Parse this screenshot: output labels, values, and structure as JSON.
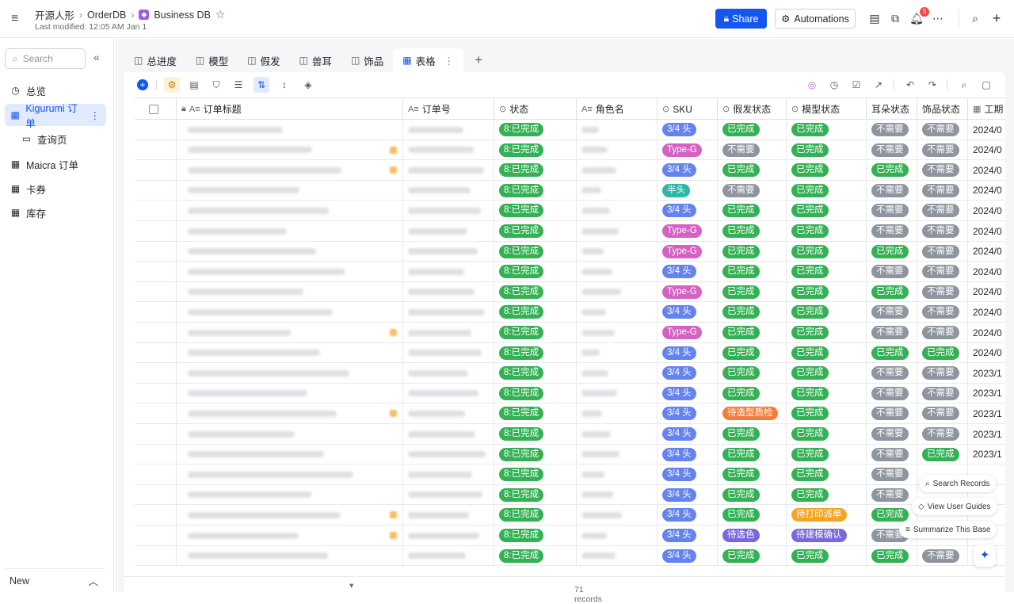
{
  "header": {
    "breadcrumb": [
      "开源人形",
      "OrderDB",
      "Business DB"
    ],
    "last_modified": "Last modified: 12:05 AM Jan 1",
    "share_label": "Share",
    "automations_label": "Automations",
    "notification_count": "5"
  },
  "sidebar": {
    "search_placeholder": "Search",
    "items": [
      {
        "label": "总览",
        "icon": "clock-icon"
      },
      {
        "label": "Kigurumi 订单",
        "icon": "table-icon",
        "active": true
      },
      {
        "label": "查询页",
        "icon": "form-icon"
      },
      {
        "label": "Maicra 订单",
        "icon": "table-icon"
      },
      {
        "label": "卡券",
        "icon": "table-icon"
      },
      {
        "label": "库存",
        "icon": "table-icon"
      }
    ],
    "new_label": "New"
  },
  "tabs": [
    {
      "label": "总进度"
    },
    {
      "label": "模型"
    },
    {
      "label": "假发"
    },
    {
      "label": "兽耳"
    },
    {
      "label": "饰品"
    },
    {
      "label": "表格",
      "active": true
    }
  ],
  "columns": [
    "订单标题",
    "订单号",
    "状态",
    "角色名",
    "SKU",
    "假发状态",
    "模型状态",
    "耳朵状态",
    "饰品状态",
    "工期"
  ],
  "rows": [
    {
      "status": "8:已完成",
      "sku": "3/4 头",
      "wig": "已完成",
      "model": "已完成",
      "ear": "不需要",
      "acc": "不需要",
      "date": "2024/0",
      "dot": false
    },
    {
      "status": "8:已完成",
      "sku": "Type-G",
      "wig": "不需要",
      "model": "已完成",
      "ear": "不需要",
      "acc": "不需要",
      "date": "2024/0",
      "dot": true
    },
    {
      "status": "8:已完成",
      "sku": "3/4 头",
      "wig": "已完成",
      "model": "已完成",
      "ear": "已完成",
      "acc": "不需要",
      "date": "2024/0",
      "dot": true
    },
    {
      "status": "8:已完成",
      "sku": "半头",
      "wig": "不需要",
      "model": "已完成",
      "ear": "不需要",
      "acc": "不需要",
      "date": "2024/0",
      "dot": false
    },
    {
      "status": "8:已完成",
      "sku": "3/4 头",
      "wig": "已完成",
      "model": "已完成",
      "ear": "不需要",
      "acc": "不需要",
      "date": "2024/0",
      "dot": false
    },
    {
      "status": "8:已完成",
      "sku": "Type-G",
      "wig": "已完成",
      "model": "已完成",
      "ear": "不需要",
      "acc": "不需要",
      "date": "2024/0",
      "dot": false
    },
    {
      "status": "8:已完成",
      "sku": "Type-G",
      "wig": "已完成",
      "model": "已完成",
      "ear": "已完成",
      "acc": "不需要",
      "date": "2024/0",
      "dot": false
    },
    {
      "status": "8:已完成",
      "sku": "3/4 头",
      "wig": "已完成",
      "model": "已完成",
      "ear": "不需要",
      "acc": "不需要",
      "date": "2024/0",
      "dot": false
    },
    {
      "status": "8:已完成",
      "sku": "Type-G",
      "wig": "已完成",
      "model": "已完成",
      "ear": "已完成",
      "acc": "不需要",
      "date": "2024/0",
      "dot": false
    },
    {
      "status": "8:已完成",
      "sku": "3/4 头",
      "wig": "已完成",
      "model": "已完成",
      "ear": "不需要",
      "acc": "不需要",
      "date": "2024/0",
      "dot": false
    },
    {
      "status": "8:已完成",
      "sku": "Type-G",
      "wig": "已完成",
      "model": "已完成",
      "ear": "不需要",
      "acc": "不需要",
      "date": "2024/0",
      "dot": true
    },
    {
      "status": "8:已完成",
      "sku": "3/4 头",
      "wig": "已完成",
      "model": "已完成",
      "ear": "已完成",
      "acc": "已完成",
      "date": "2024/0",
      "dot": false
    },
    {
      "status": "8:已完成",
      "sku": "3/4 头",
      "wig": "已完成",
      "model": "已完成",
      "ear": "不需要",
      "acc": "不需要",
      "date": "2023/1",
      "dot": false
    },
    {
      "status": "8:已完成",
      "sku": "3/4 头",
      "wig": "已完成",
      "model": "已完成",
      "ear": "不需要",
      "acc": "不需要",
      "date": "2023/1",
      "dot": false
    },
    {
      "status": "8:已完成",
      "sku": "3/4 头",
      "wig": "待造型质检",
      "model": "已完成",
      "ear": "不需要",
      "acc": "不需要",
      "date": "2023/1",
      "dot": true
    },
    {
      "status": "8:已完成",
      "sku": "3/4 头",
      "wig": "已完成",
      "model": "已完成",
      "ear": "不需要",
      "acc": "不需要",
      "date": "2023/1",
      "dot": false
    },
    {
      "status": "8:已完成",
      "sku": "3/4 头",
      "wig": "已完成",
      "model": "已完成",
      "ear": "不需要",
      "acc": "已完成",
      "date": "2023/1",
      "dot": false
    },
    {
      "status": "8:已完成",
      "sku": "3/4 头",
      "wig": "已完成",
      "model": "已完成",
      "ear": "不需要",
      "acc": "",
      "date": "",
      "dot": false
    },
    {
      "status": "8:已完成",
      "sku": "3/4 头",
      "wig": "已完成",
      "model": "已完成",
      "ear": "不需要",
      "acc": "",
      "date": "",
      "dot": false
    },
    {
      "status": "8:已完成",
      "sku": "3/4 头",
      "wig": "已完成",
      "model": "待打印派单",
      "ear": "已完成",
      "acc": "",
      "date": "",
      "dot": true
    },
    {
      "status": "8:已完成",
      "sku": "3/4 头",
      "wig": "待选色",
      "model": "待建模确认",
      "ear": "不需要",
      "acc": "",
      "date": "",
      "dot": true
    },
    {
      "status": "8:已完成",
      "sku": "3/4 头",
      "wig": "已完成",
      "model": "已完成",
      "ear": "已完成",
      "acc": "不需要",
      "date": "",
      "dot": false
    }
  ],
  "footer": {
    "records": "71 records"
  },
  "floating": {
    "search_records": "Search Records",
    "user_guides": "View User Guides",
    "summarize": "Summarize This Base"
  }
}
